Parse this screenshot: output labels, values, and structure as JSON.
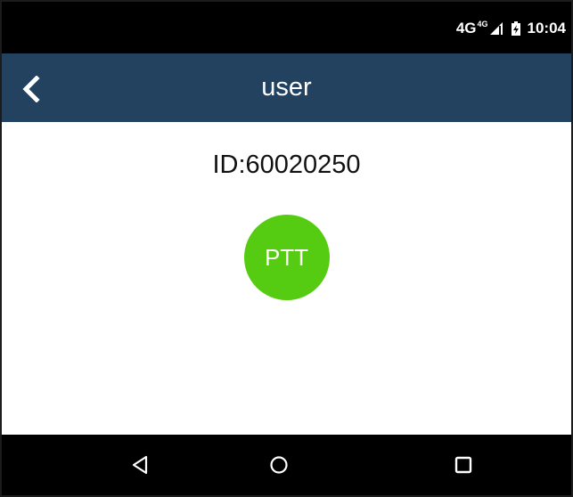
{
  "status_bar": {
    "network": "4G",
    "network_sup": "4G",
    "signal_icon": "cell-signal-icon",
    "battery_icon": "battery-charging-icon",
    "time": "10:04"
  },
  "app_bar": {
    "back_icon": "chevron-left-icon",
    "title": "user",
    "background": "#22425f"
  },
  "content": {
    "user_id": "ID:60020250",
    "ptt_label": "PTT",
    "ptt_color": "#55cc11"
  },
  "nav_bar": {
    "back_icon": "triangle-back-icon",
    "home_icon": "circle-home-icon",
    "recents_icon": "square-recents-icon"
  }
}
